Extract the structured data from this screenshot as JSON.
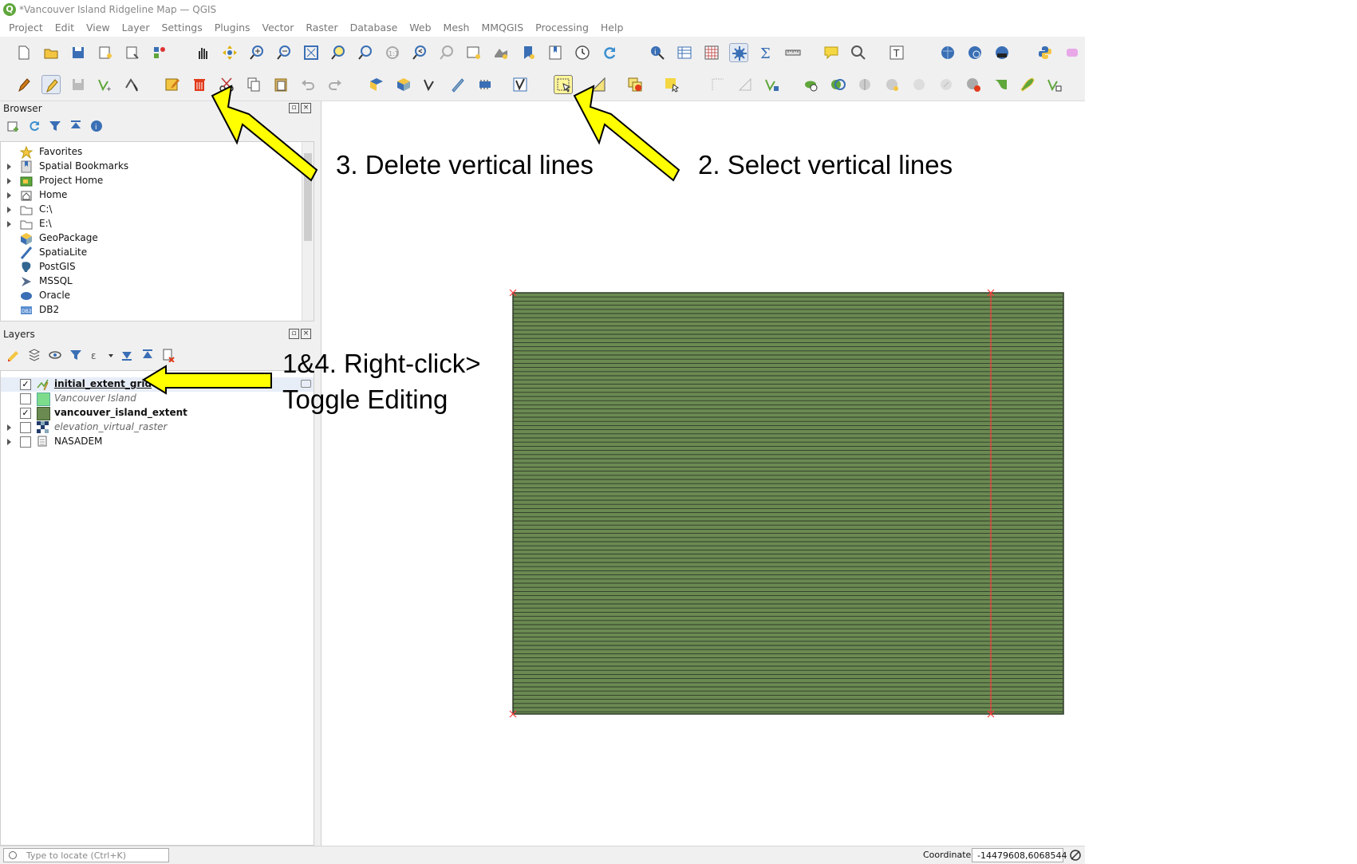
{
  "window": {
    "title": "*Vancouver Island Ridgeline Map — QGIS"
  },
  "menu": [
    "Project",
    "Edit",
    "View",
    "Layer",
    "Settings",
    "Plugins",
    "Vector",
    "Raster",
    "Database",
    "Web",
    "Mesh",
    "MMQGIS",
    "Processing",
    "Help"
  ],
  "browser": {
    "title": "Browser",
    "items": [
      {
        "label": "Favorites",
        "icon": "star-icon",
        "expandable": false
      },
      {
        "label": "Spatial Bookmarks",
        "icon": "bookmark-icon",
        "expandable": true
      },
      {
        "label": "Project Home",
        "icon": "project-home-icon",
        "expandable": true
      },
      {
        "label": "Home",
        "icon": "home-folder-icon",
        "expandable": true
      },
      {
        "label": "C:\\",
        "icon": "folder-icon",
        "expandable": true
      },
      {
        "label": "E:\\",
        "icon": "folder-icon",
        "expandable": true
      },
      {
        "label": "GeoPackage",
        "icon": "geopackage-icon",
        "expandable": false
      },
      {
        "label": "SpatiaLite",
        "icon": "spatialite-icon",
        "expandable": false
      },
      {
        "label": "PostGIS",
        "icon": "postgis-icon",
        "expandable": false
      },
      {
        "label": "MSSQL",
        "icon": "mssql-icon",
        "expandable": false
      },
      {
        "label": "Oracle",
        "icon": "oracle-icon",
        "expandable": false
      },
      {
        "label": "DB2",
        "icon": "db2-icon",
        "expandable": false
      }
    ]
  },
  "layers": {
    "title": "Layers",
    "items": [
      {
        "label": "initial_extent_grid",
        "checked": true,
        "icon": "line-layer-editing-icon",
        "style": "bold-underline",
        "expandable": false
      },
      {
        "label": "Vancouver Island",
        "checked": false,
        "icon": "polygon-layer-light-green-icon",
        "style": "italic",
        "expandable": false
      },
      {
        "label": "vancouver_island_extent",
        "checked": true,
        "icon": "polygon-layer-green-icon",
        "style": "bold",
        "expandable": false
      },
      {
        "label": "elevation_virtual_raster",
        "checked": false,
        "icon": "raster-layer-icon",
        "style": "italic",
        "expandable": true
      },
      {
        "label": "NASADEM",
        "checked": false,
        "icon": "layer-group-icon",
        "style": "normal",
        "expandable": true
      }
    ]
  },
  "statusbar": {
    "locate_placeholder": "Type to locate (Ctrl+K)",
    "coordinate_label": "Coordinate",
    "coordinate_value": "-14479608,6068544"
  },
  "annotations": {
    "step3": "3. Delete vertical lines",
    "step2": "2. Select vertical lines",
    "step14_line1": "1&4. Right-click>",
    "step14_line2": "Toggle Editing"
  },
  "map": {
    "fill_color": "#6b8a52",
    "line_color": "#2e3a28",
    "selected_color": "#ff3b3b"
  },
  "colors": {
    "arrow_fill": "#ffff00",
    "arrow_stroke": "#000000"
  }
}
